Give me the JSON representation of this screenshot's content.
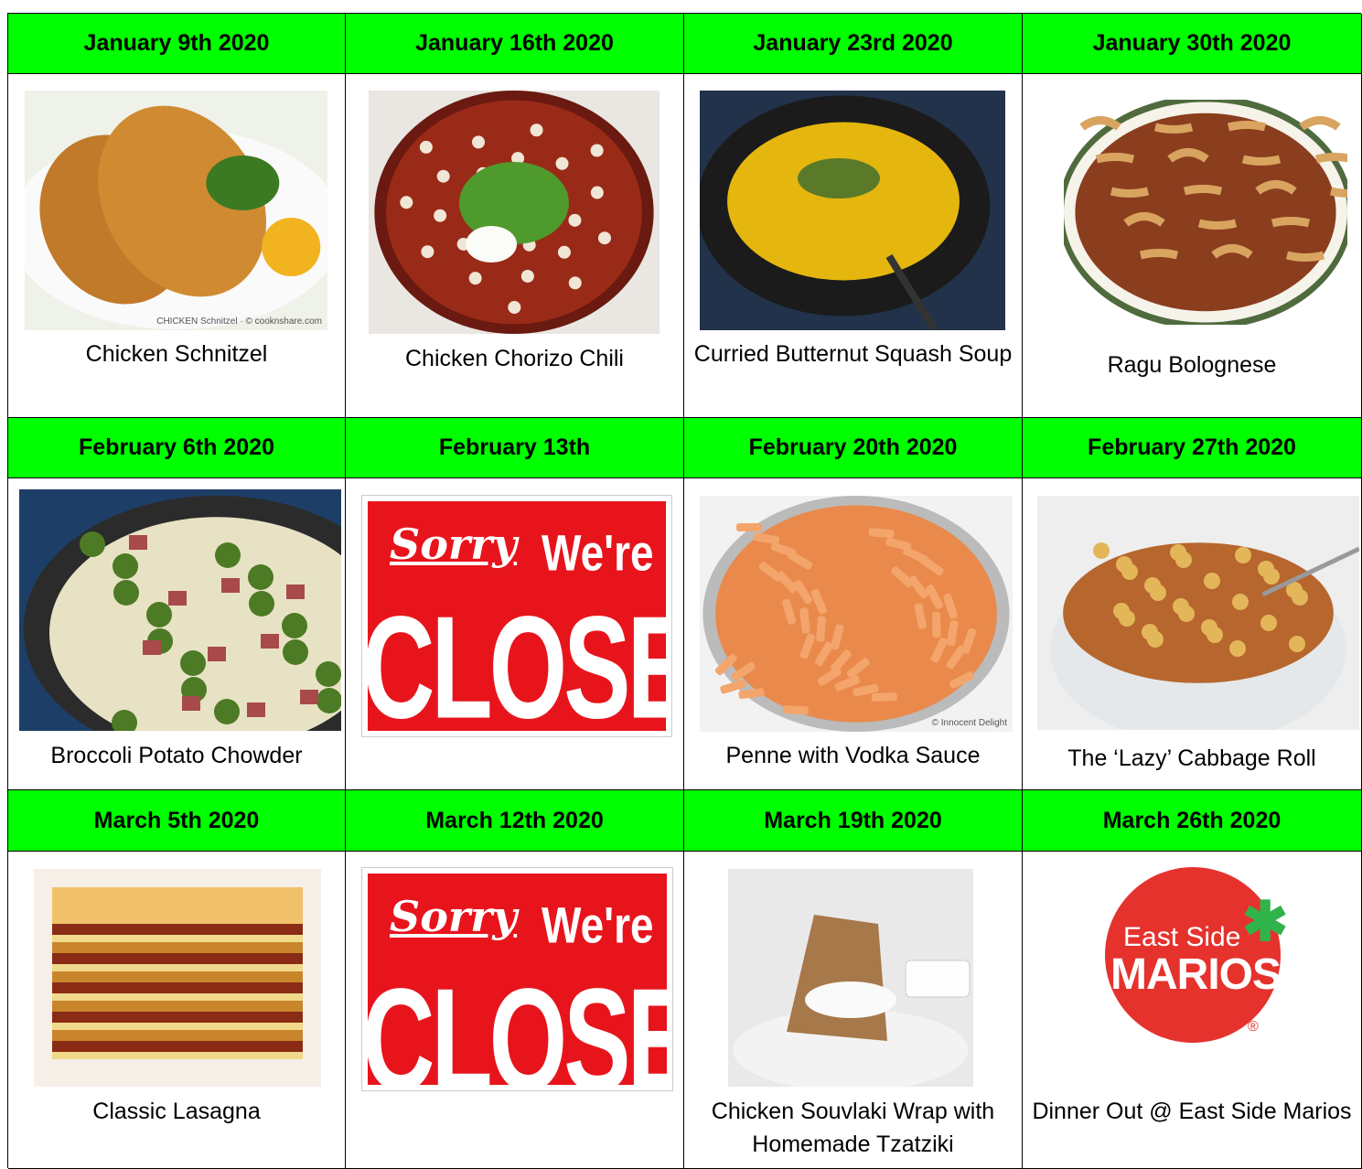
{
  "weeks": [
    {
      "date": "January 9th 2020",
      "dish": "Chicken Schnitzel",
      "image": "chicken-schnitzel",
      "image_text": "CHICKEN Schnitzel · © cooknshare.com"
    },
    {
      "date": "January 16th 2020",
      "dish": "Chicken Chorizo Chili",
      "image": "chorizo-chili"
    },
    {
      "date": "January 23rd 2020",
      "dish": "Curried Butternut Squash Soup",
      "image": "squash-soup"
    },
    {
      "date": "January 30th 2020",
      "dish": "Ragu Bolognese",
      "image": "ragu-bolognese"
    },
    {
      "date": "February 6th 2020",
      "dish": "Broccoli Potato Chowder",
      "image": "broccoli-chowder"
    },
    {
      "date": "February 13th",
      "dish": "",
      "image": "closed-sign",
      "sign": {
        "sorry": "Sorry",
        "were": "We're",
        "closed": "CLOSED"
      }
    },
    {
      "date": "February 20th 2020",
      "dish": "Penne with Vodka Sauce",
      "image": "penne-vodka",
      "image_text": "© Innocent Delight"
    },
    {
      "date": "February 27th 2020",
      "dish": "The ‘Lazy’ Cabbage Roll",
      "image": "cabbage-roll"
    },
    {
      "date": "March 5th 2020",
      "dish": "Classic Lasagna",
      "image": "lasagna"
    },
    {
      "date": "March 12th 2020",
      "dish": "",
      "image": "closed-sign",
      "sign": {
        "sorry": "Sorry",
        "were": "We're",
        "closed": "CLOSED"
      }
    },
    {
      "date": "March 19th 2020",
      "dish": "Chicken Souvlaki Wrap with Homemade Tzatziki",
      "image": "souvlaki-wrap"
    },
    {
      "date": "March 26th 2020",
      "dish": "Dinner Out @ East Side Marios",
      "image": "east-side-marios-logo",
      "logo": {
        "line1": "East Side",
        "line2": "MARIOS",
        "reg": "®"
      }
    }
  ]
}
